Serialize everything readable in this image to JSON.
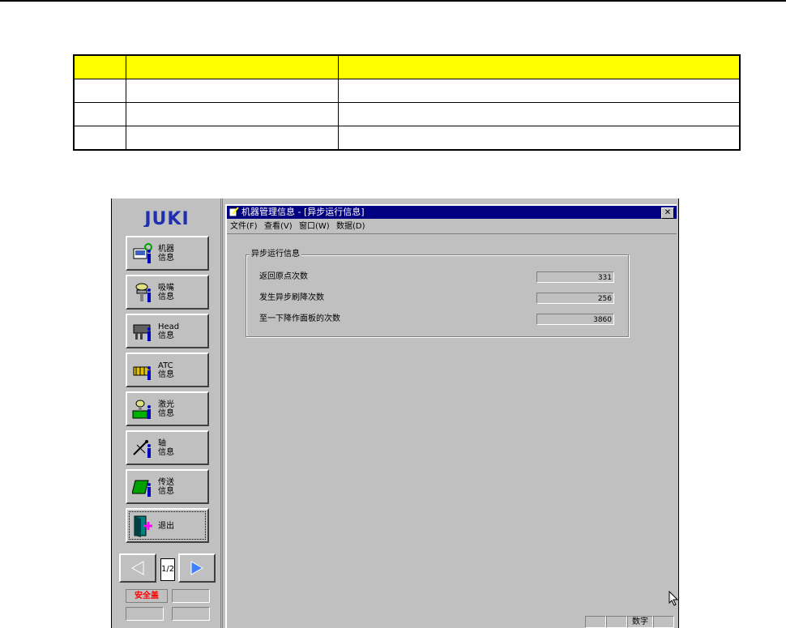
{
  "table": {
    "rows": [
      [
        "",
        "",
        ""
      ],
      [
        "",
        "",
        ""
      ],
      [
        "",
        "",
        ""
      ],
      [
        "",
        "",
        ""
      ]
    ]
  },
  "panel": {
    "logo": "JUKI",
    "buttons": [
      {
        "label": "机器\n信息",
        "icon": "machine-info-icon"
      },
      {
        "label": "吸嘴\n信息",
        "icon": "nozzle-info-icon"
      },
      {
        "label": "Head\n信息",
        "icon": "head-info-icon"
      },
      {
        "label": "ATC\n信息",
        "icon": "atc-info-icon"
      },
      {
        "label": "激光\n信息",
        "icon": "laser-info-icon"
      },
      {
        "label": "轴\n信息",
        "icon": "axis-info-icon"
      },
      {
        "label": "传送\n信息",
        "icon": "conveyor-info-icon"
      },
      {
        "label": "退出",
        "icon": "exit-door-icon"
      }
    ],
    "page_indicator": "1/2",
    "safety_label": "安全盖"
  },
  "window": {
    "title": "机器管理信息 - [异步运行信息]",
    "close_glyph": "✕",
    "menu": [
      "文件(F)",
      "查看(V)",
      "窗口(W)",
      "数据(D)"
    ],
    "group_title": "异步运行信息",
    "rows": [
      {
        "label": "返回原点次数",
        "value": "331"
      },
      {
        "label": "发生异步刷降次数",
        "value": "256"
      },
      {
        "label": "至一下降作面板的次数",
        "value": "3860"
      }
    ],
    "status_numlock": "数字"
  },
  "colors": {
    "titlebar": "#000080",
    "face": "#c0c0c0",
    "header_yellow": "#ffff00",
    "safety_red": "#ff0000"
  }
}
